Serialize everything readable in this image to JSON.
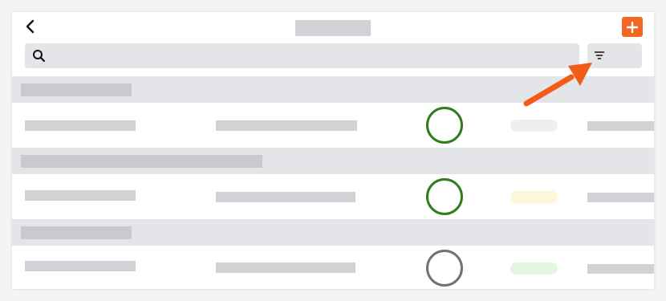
{
  "colors": {
    "accent": "#f26722",
    "placeholder": "#d1d1d6",
    "surface": "#e3e5e8",
    "ring_complete": "#2e7d1e",
    "ring_neutral": "#6e7378",
    "pill_gray": "#eeeff1",
    "pill_yellow": "#fdf7da",
    "pill_green": "#e3f7e0",
    "annotation": "#f25c19"
  },
  "header": {
    "back_icon": "chevron-left-icon",
    "add_icon": "plus-icon"
  },
  "search": {
    "icon": "search-icon",
    "placeholder": "",
    "value": ""
  },
  "filter": {
    "icon": "filter-icon"
  },
  "annotation": {
    "icon": "arrow-annotation",
    "points_to": "filter-button"
  },
  "groups": [
    {
      "rows": [
        {
          "progress": 1.0,
          "ring": "complete",
          "pill": "gray"
        }
      ]
    },
    {
      "rows": [
        {
          "progress": 1.0,
          "ring": "complete",
          "pill": "yellow"
        }
      ]
    },
    {
      "rows": [
        {
          "progress": 1.0,
          "ring": "neutral",
          "pill": "green"
        }
      ]
    }
  ]
}
